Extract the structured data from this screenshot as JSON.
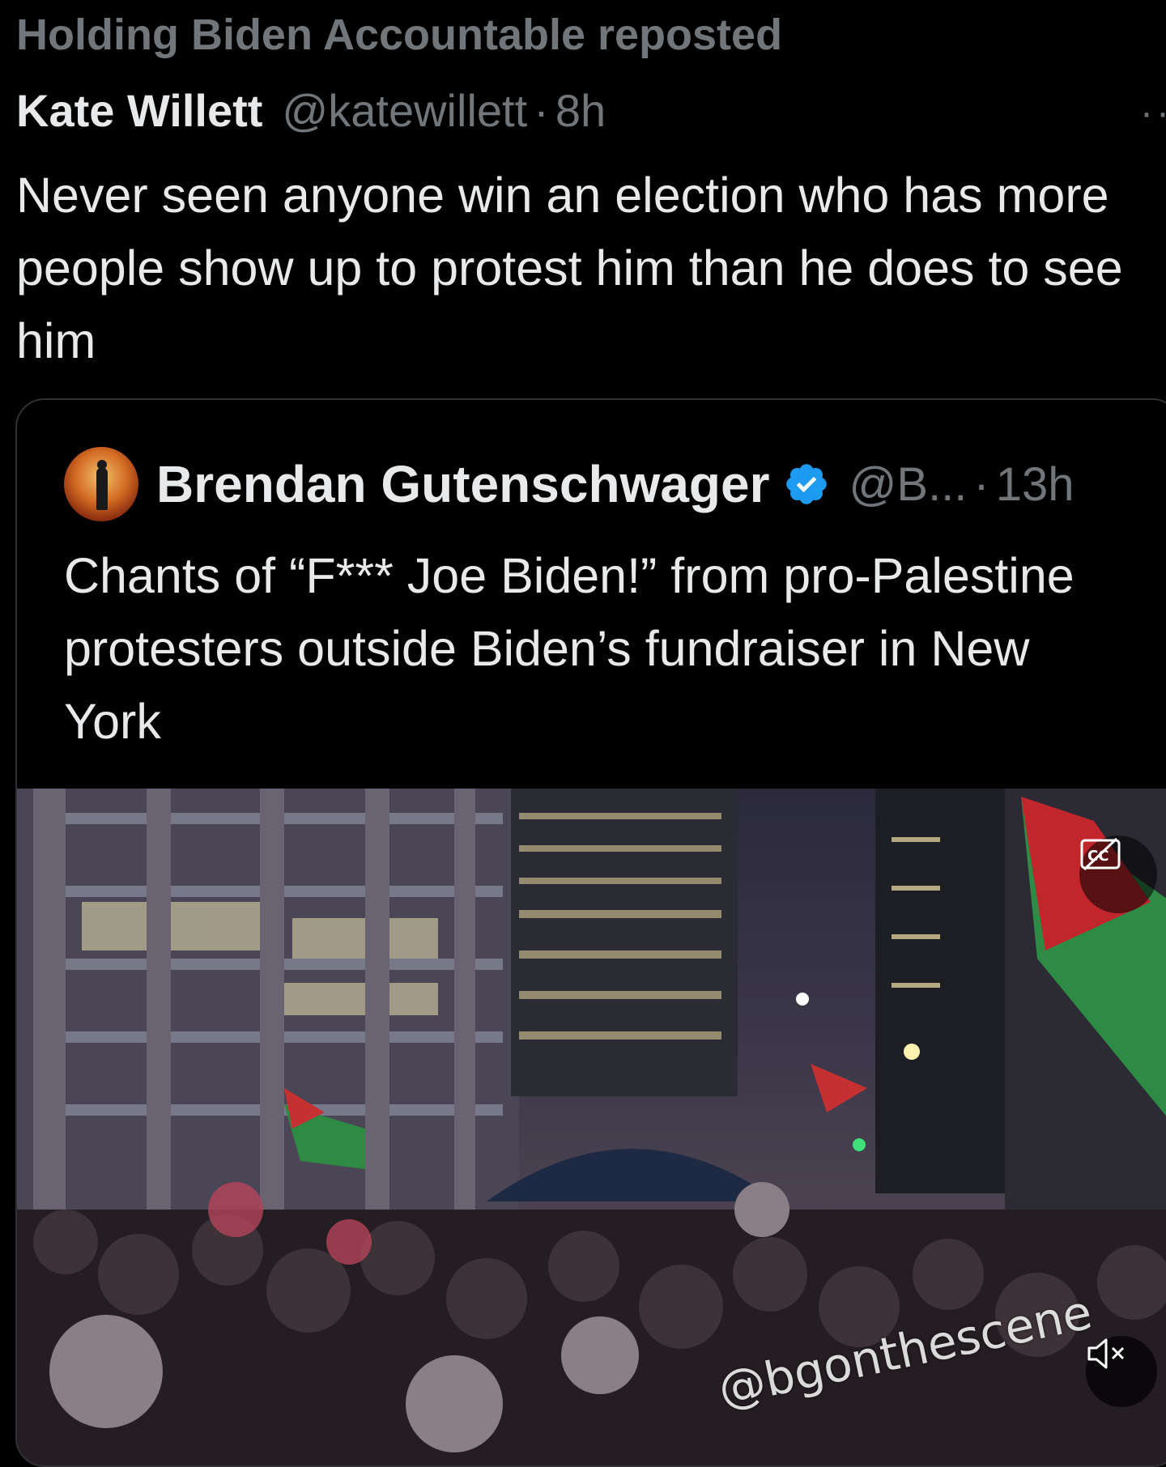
{
  "repost": {
    "label": "Holding Biden Accountable reposted"
  },
  "tweet": {
    "author_name": "Kate Willett",
    "handle": "@katewillett",
    "separator": "·",
    "time": "8h",
    "text": "Never seen anyone win an election who has more people show up to protest him than he does to see him"
  },
  "quote": {
    "author_name": "Brendan Gutenschwager",
    "verified": true,
    "handle": "@B...",
    "separator": "·",
    "time": "13h",
    "text": "Chants of “F*** Joe Biden!” from pro-Palestine protesters outside Biden’s fundraiser in New York",
    "media": {
      "watermark": "@bgonthescene",
      "captions_icon": "closed-captions-icon",
      "mute_icon": "muted-speaker-icon"
    }
  },
  "colors": {
    "background": "#000000",
    "text_primary": "#e7e9ea",
    "text_secondary": "#71767b",
    "border": "#2f3336",
    "verified_blue": "#1d9bf0"
  }
}
